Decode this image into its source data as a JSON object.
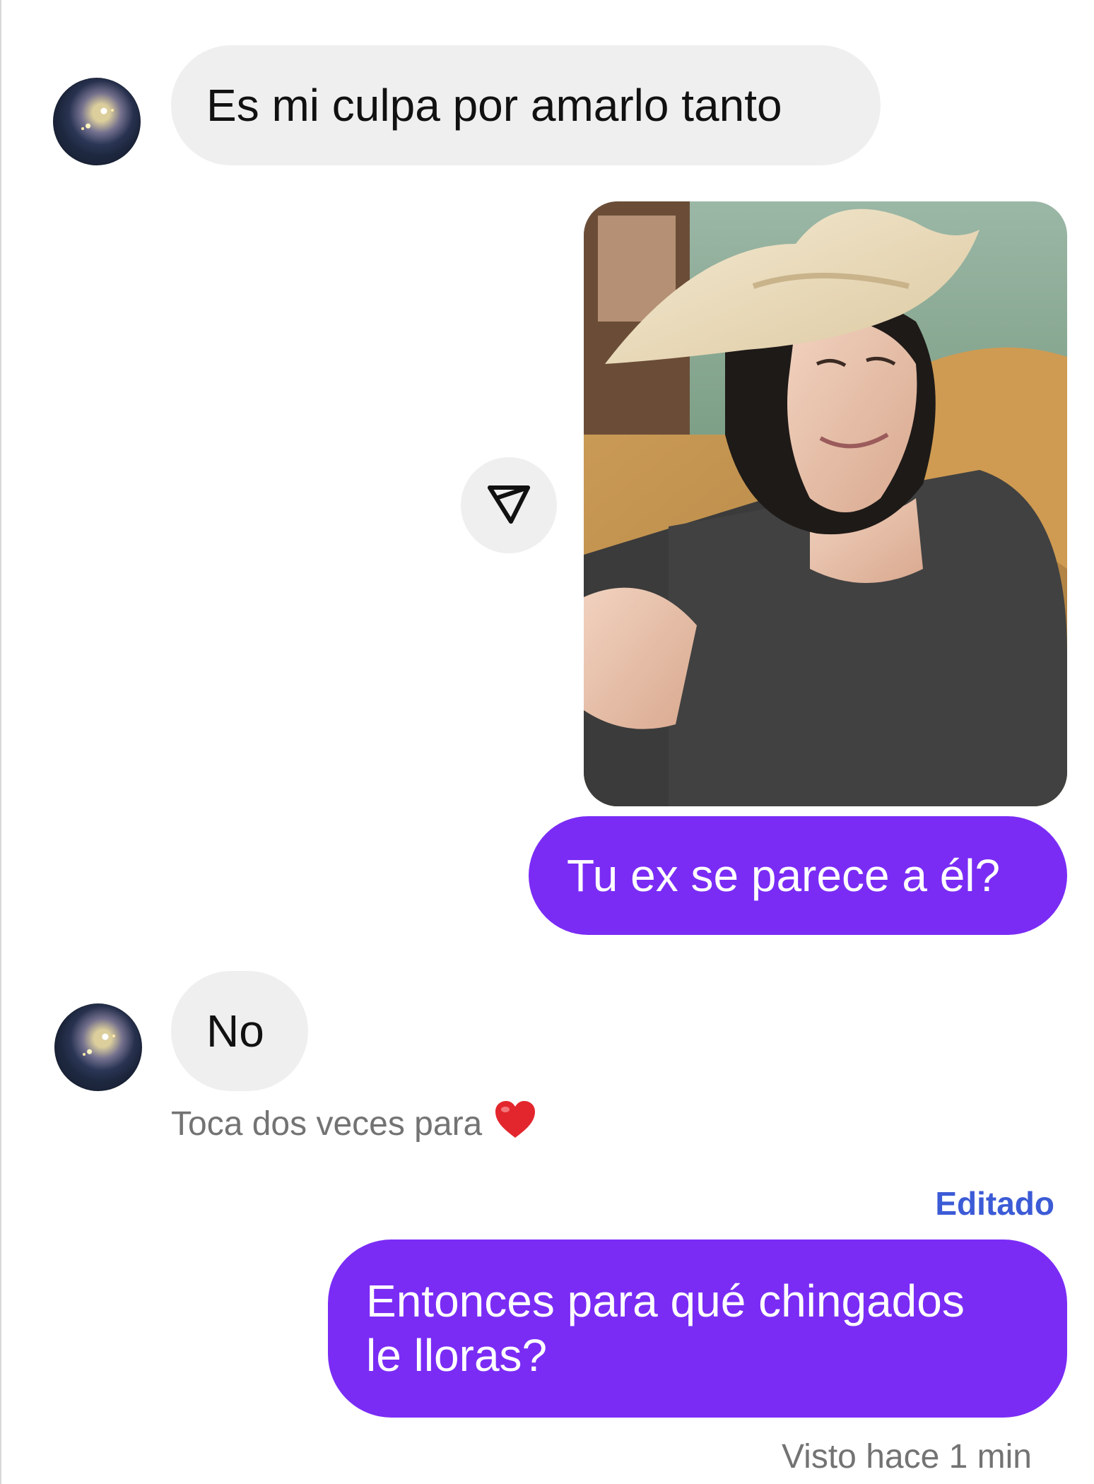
{
  "messages": {
    "incoming_1": "Es mi culpa por amarlo tanto",
    "outgoing_1": "Tu ex se parece a él?",
    "incoming_2": "No",
    "outgoing_2_line1": "Entonces para qué chingados",
    "outgoing_2_line2": "le lloras?"
  },
  "reaction_hint": "Toca dos veces para",
  "edited_label": "Editado",
  "seen_status": "Visto hace 1 min",
  "icons": {
    "share": "paper-plane-icon",
    "reaction": "heart-icon",
    "avatar": "galaxy-avatar"
  },
  "colors": {
    "outgoing_bubble": "#7a2cf5",
    "incoming_bubble": "#efefef",
    "edited": "#3c5bd6",
    "meta_text": "#737373"
  }
}
